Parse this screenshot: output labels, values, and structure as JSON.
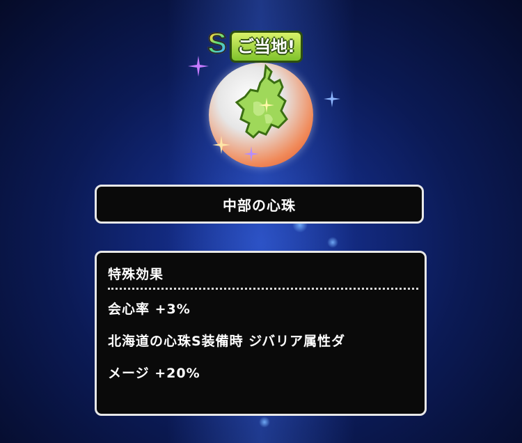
{
  "item": {
    "rank_letter": "S",
    "badge_label": "ご当地!",
    "name": "中部の心珠"
  },
  "effect": {
    "title": "特殊効果",
    "lines": [
      "会心率 +3%",
      "北海道の心珠S装備時 ジバリア属性ダ",
      "メージ +20%"
    ]
  },
  "colors": {
    "background": "#0b1a55",
    "panel_bg": "#0a0a0a",
    "panel_border": "#e8e8e8",
    "badge_green": "#7ec22b",
    "gem_orange": "#e0461a"
  },
  "icons": {
    "gem": "chubu-region-map-gem-icon",
    "sparkle": "sparkle-star-icon"
  }
}
